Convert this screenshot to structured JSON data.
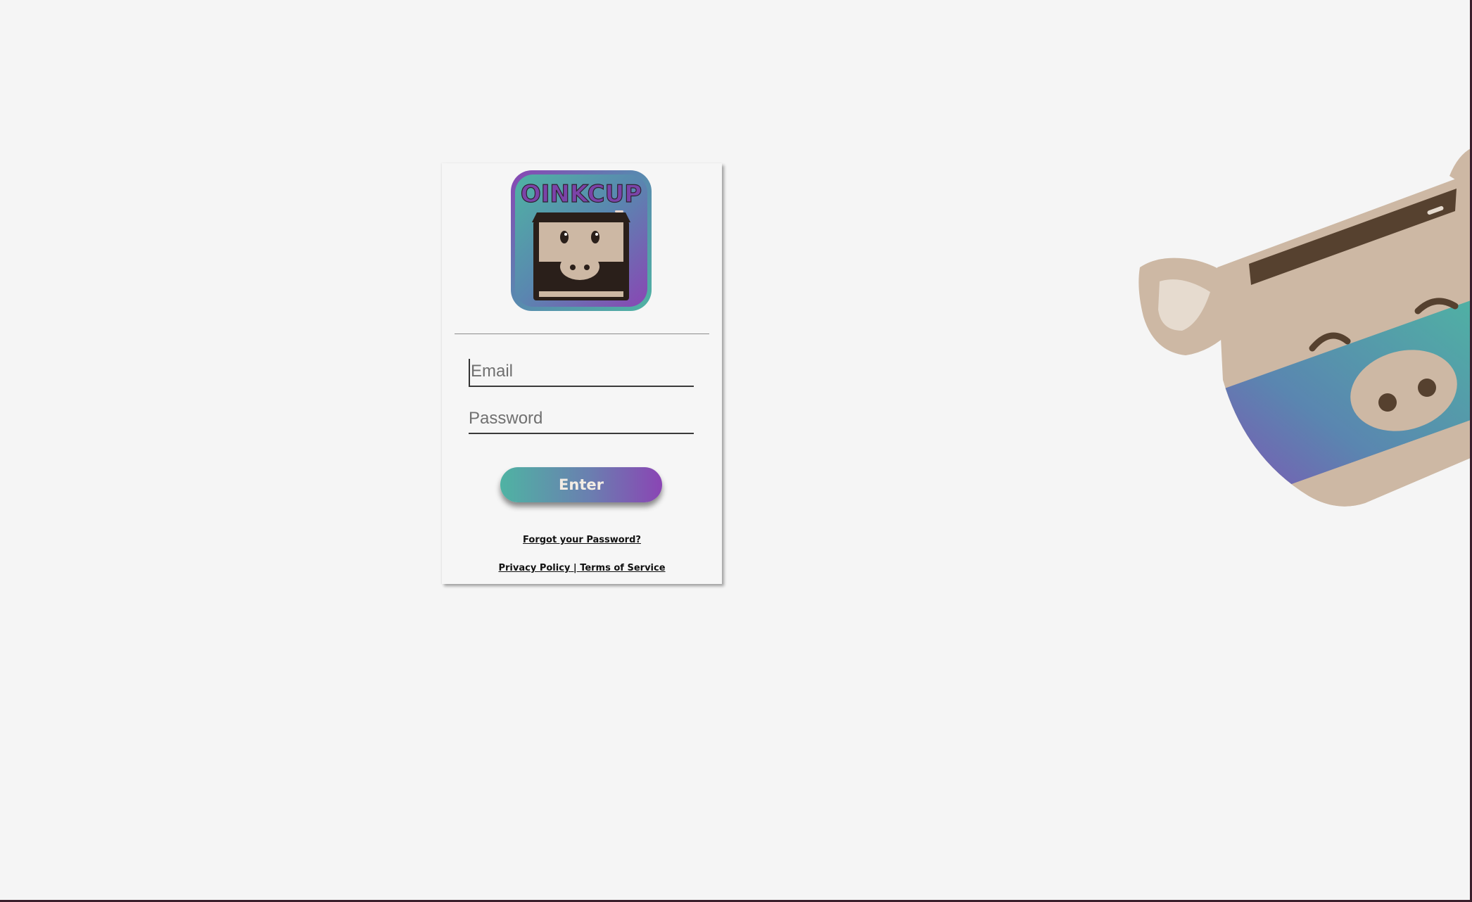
{
  "login": {
    "logo_text": "OINKCUP",
    "email_placeholder": "Email",
    "password_placeholder": "Password",
    "enter_label": "Enter",
    "forgot_label": "Forgot your Password?",
    "privacy_label": "Privacy Policy",
    "separator": " | ",
    "terms_label": "Terms of Service"
  },
  "colors": {
    "background": "#f5f5f5",
    "teal": "#4fb3a3",
    "purple": "#8a45b4",
    "pig_skin": "#cdb8a4",
    "pig_dark": "#56412f"
  },
  "icons": {
    "logo": "oinkcup-pig-cup-logo",
    "mascot": "pig-mascot-illustration"
  }
}
